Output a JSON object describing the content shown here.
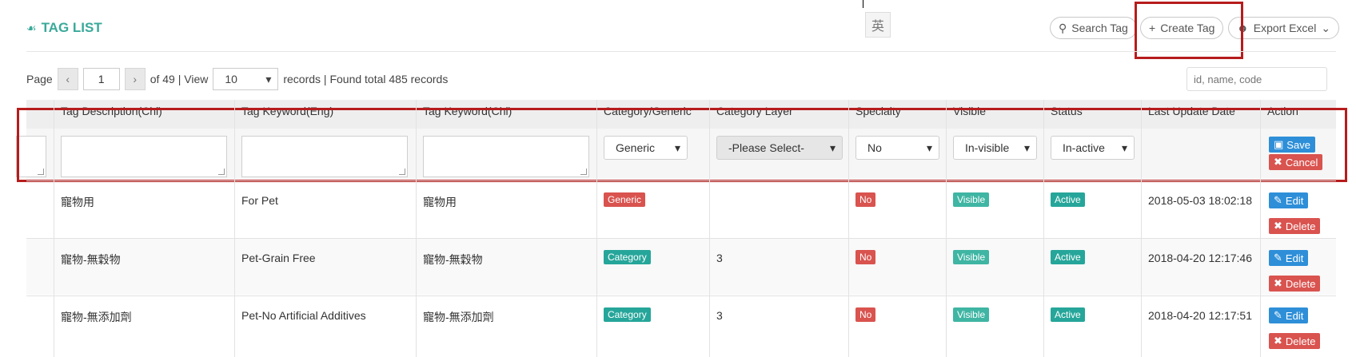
{
  "ime_char": "英",
  "title": "TAG LIST",
  "toolbar": {
    "search_label": "Search Tag",
    "create_label": "Create Tag",
    "export_label": "Export Excel"
  },
  "pager": {
    "page_label": "Page",
    "prev": "‹",
    "next": "›",
    "page_value": "1",
    "of_text": "of 49 | View",
    "view_value": "10",
    "records_text": "records | Found total 485 records",
    "filter_placeholder": "id, name, code"
  },
  "headers": {
    "desc_chi": "Tag Description(Chi)",
    "kw_eng": "Tag Keyword(Eng)",
    "kw_chi": "Tag Keyword(Chi)",
    "category": "Category/Generic",
    "layer": "Category Layer",
    "specialty": "Specialty",
    "visible": "Visible",
    "status": "Status",
    "updated": "Last Update Date",
    "action": "Action"
  },
  "edit_row": {
    "category": "Generic",
    "layer": "-Please Select-",
    "specialty": "No",
    "visible": "In-visible",
    "status": "In-active",
    "save": "Save",
    "cancel": "Cancel"
  },
  "rows": [
    {
      "desc_chi": "寵物用",
      "kw_eng": "For Pet",
      "kw_chi": "寵物用",
      "category": "Generic",
      "layer": "",
      "specialty": "No",
      "visible": "Visible",
      "status": "Active",
      "updated": "2018-05-03 18:02:18",
      "edit": "Edit",
      "delete": "Delete"
    },
    {
      "desc_chi": "寵物-無穀物",
      "kw_eng": "Pet-Grain Free",
      "kw_chi": "寵物-無穀物",
      "category": "Category",
      "layer": "3",
      "specialty": "No",
      "visible": "Visible",
      "status": "Active",
      "updated": "2018-04-20 12:17:46",
      "edit": "Edit",
      "delete": "Delete"
    },
    {
      "desc_chi": "寵物-無添加劑",
      "kw_eng": "Pet-No Artificial Additives",
      "kw_chi": "寵物-無添加劑",
      "category": "Category",
      "layer": "3",
      "specialty": "No",
      "visible": "Visible",
      "status": "Active",
      "updated": "2018-04-20 12:17:51",
      "edit": "Edit",
      "delete": "Delete"
    }
  ],
  "colors": {
    "accent_teal": "#3aa99a",
    "highlight_red": "#b71c1c",
    "badge_red": "#d9534f",
    "badge_teal": "#3fb5a3",
    "button_blue": "#2e8fd8"
  }
}
